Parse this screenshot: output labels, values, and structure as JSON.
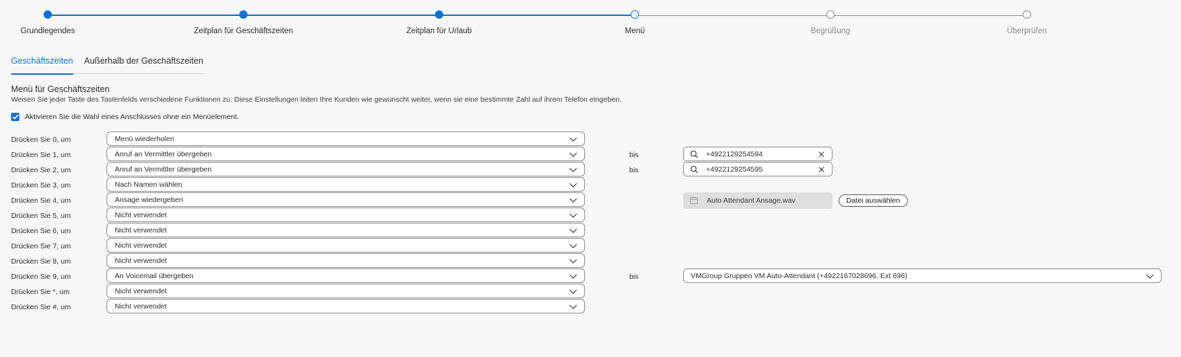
{
  "stepper": {
    "steps": [
      {
        "label": "Grundlegendes",
        "state": "done"
      },
      {
        "label": "Zeitplan für Geschäftszeiten",
        "state": "done"
      },
      {
        "label": "Zeitplan für Urlaub",
        "state": "done"
      },
      {
        "label": "Menü",
        "state": "current"
      },
      {
        "label": "Begrüßung",
        "state": "todo"
      },
      {
        "label": "Überprüfen",
        "state": "todo"
      }
    ]
  },
  "tabs": {
    "business_hours": "Geschäftszeiten",
    "after_hours": "Außerhalb der Geschäftszeiten",
    "active": "business_hours"
  },
  "section": {
    "title": "Menü für Geschäftszeiten",
    "description": "Weisen Sie jeder Taste des Tastenfelds verschiedene Funktionen zu. Diese Einstellungen leiten Ihre Kunden wie gewünscht weiter, wenn sie eine bestimmte Zahl auf ihrem Telefon eingeben.",
    "checkbox_label": "Aktivieren Sie die Wahl eines Anschlusses ohne ein Menüelement.",
    "checkbox_checked": true
  },
  "keys": {
    "k0": {
      "label": "Drücken Sie 0, um",
      "action": "Menü wiederholen"
    },
    "k1": {
      "label": "Drücken Sie 1, um",
      "action": "Anruf an Vermittler übergeben",
      "bis": "bis",
      "number": "+4922129254594"
    },
    "k2": {
      "label": "Drücken Sie 2, um",
      "action": "Anruf an Vermittler übergeben",
      "bis": "bis",
      "number": "+4922129254595"
    },
    "k3": {
      "label": "Drücken Sie 3, um",
      "action": "Nach Namen wählen"
    },
    "k4": {
      "label": "Drücken Sie 4, um",
      "action": "Ansage wiedergeben",
      "file_name": "Auto Attendant Ansage.wav",
      "file_button": "Datei auswählen"
    },
    "k5": {
      "label": "Drücken Sie 5, um",
      "action": "Nicht verwendet"
    },
    "k6": {
      "label": "Drücken Sie 6, um",
      "action": "Nicht verwendet"
    },
    "k7": {
      "label": "Drücken Sie 7, um",
      "action": "Nicht verwendet"
    },
    "k8": {
      "label": "Drücken Sie 8, um",
      "action": "Nicht verwendet"
    },
    "k9": {
      "label": "Drücken Sie 9, um",
      "action": "An Voicemail übergeben",
      "bis": "bis",
      "voicemail": "VMGroup Gruppen VM Auto-Attendant (+4922167028696, Ext 696)"
    },
    "kstar": {
      "label": "Drücken Sie *, um",
      "action": "Nicht verwendet"
    },
    "khash": {
      "label": "Drücken Sie #, um",
      "action": "Nicht verwendet"
    }
  },
  "colors": {
    "accent": "#1170cf",
    "inactive": "#8a8a8a",
    "background": "#f7f7f7"
  },
  "icons": {
    "dropdown": "chevron-down-icon",
    "search": "search-icon",
    "clear": "close-icon",
    "file": "file-icon",
    "check": "check-icon"
  }
}
